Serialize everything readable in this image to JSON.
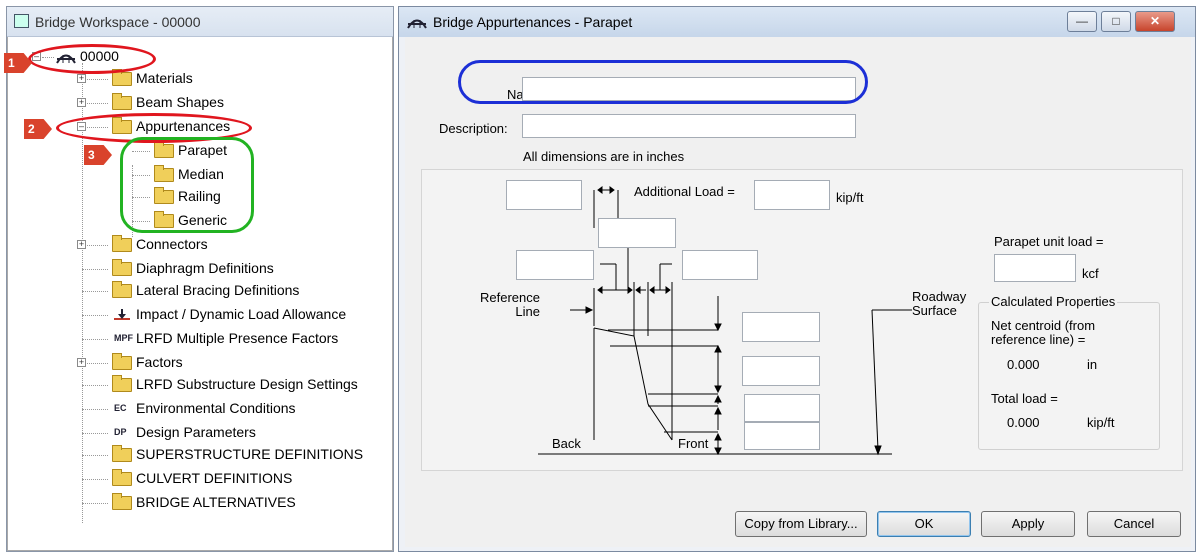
{
  "workspace": {
    "title": "Bridge Workspace - 00000",
    "root": "00000",
    "items": [
      {
        "label": "Materials",
        "icon": "folder-icon",
        "expander": "plus"
      },
      {
        "label": "Beam Shapes",
        "icon": "folder-icon",
        "expander": "plus"
      },
      {
        "label": "Appurtenances",
        "icon": "folder-icon",
        "expander": "minus"
      },
      {
        "label": "Parapet",
        "icon": "folder-icon"
      },
      {
        "label": "Median",
        "icon": "folder-icon"
      },
      {
        "label": "Railing",
        "icon": "folder-icon"
      },
      {
        "label": "Generic",
        "icon": "folder-icon"
      },
      {
        "label": "Connectors",
        "icon": "folder-icon",
        "expander": "plus"
      },
      {
        "label": "Diaphragm Definitions",
        "icon": "folder-icon"
      },
      {
        "label": "Lateral Bracing Definitions",
        "icon": "folder-icon"
      },
      {
        "label": "Impact / Dynamic Load Allowance",
        "icon": "impact-icon"
      },
      {
        "label": "LRFD Multiple Presence Factors",
        "icon": "mpf-icon",
        "icon_text": "MPF"
      },
      {
        "label": "Factors",
        "icon": "folder-icon",
        "expander": "plus"
      },
      {
        "label": "LRFD Substructure Design Settings",
        "icon": "folder-icon"
      },
      {
        "label": "Environmental Conditions",
        "icon": "ec-icon",
        "icon_text": "EC"
      },
      {
        "label": "Design Parameters",
        "icon": "dp-icon",
        "icon_text": "DP"
      },
      {
        "label": "SUPERSTRUCTURE DEFINITIONS",
        "icon": "folder-icon"
      },
      {
        "label": "CULVERT DEFINITIONS",
        "icon": "folder-icon"
      },
      {
        "label": "BRIDGE ALTERNATIVES",
        "icon": "folder-icon"
      }
    ],
    "callouts": [
      "1",
      "2",
      "3"
    ]
  },
  "dialog": {
    "title": "Bridge Appurtenances - Parapet",
    "name_label": "Name:",
    "name_value": "",
    "description_label": "Description:",
    "description_value": "",
    "dimensions_note": "All dimensions are in inches",
    "additional_load_label": "Additional Load =",
    "additional_load_unit": "kip/ft",
    "parapet_unit_load_label": "Parapet unit load =",
    "parapet_unit_load_unit": "kcf",
    "reference_line_label": "Reference\nLine",
    "roadway_surface_label": "Roadway\nSurface",
    "back_label": "Back",
    "front_label": "Front",
    "calculated_properties": {
      "group_title": "Calculated Properties",
      "net_centroid_label": "Net centroid (from reference line) =",
      "net_centroid_value": "0.000",
      "net_centroid_unit": "in",
      "total_load_label": "Total load =",
      "total_load_value": "0.000",
      "total_load_unit": "kip/ft"
    },
    "buttons": {
      "copy": "Copy from Library...",
      "ok": "OK",
      "apply": "Apply",
      "cancel": "Cancel"
    },
    "window_buttons": {
      "minimize": "—",
      "maximize": "□",
      "close": "✕"
    }
  },
  "colors": {
    "callout_red": "#d9432c",
    "ring_red": "#e0161e",
    "ring_blue": "#1c2fd6",
    "ring_green": "#22b322"
  }
}
